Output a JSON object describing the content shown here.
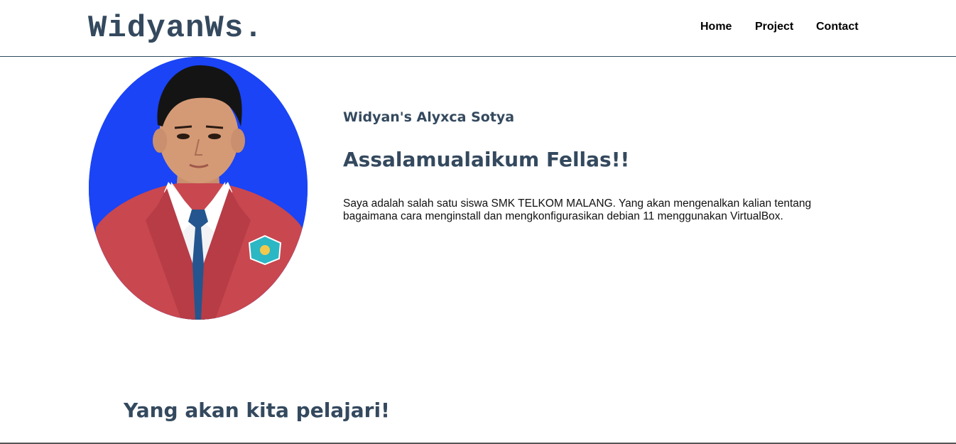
{
  "navbar": {
    "logo": "WidyanWs.",
    "links": [
      {
        "label": "Home"
      },
      {
        "label": "Project"
      },
      {
        "label": "Contact"
      }
    ]
  },
  "hero": {
    "photo_description": "profile-photo",
    "name": "Widyan's Alyxca Sotya",
    "greeting": "Assalamualaikum Fellas!!",
    "intro_line_1": "Saya adalah salah satu siswa SMK TELKOM MALANG. Yang akan mengenalkan kalian tentang",
    "intro_line_2": "bagaimana cara menginstall dan mengkonfigurasikan debian 11 menggunakan VirtualBox."
  },
  "section": {
    "title": "Yang akan kita pelajari!"
  },
  "colors": {
    "heading": "#34495e",
    "photo_background": "#1a44f5",
    "blazer": "#c9474f"
  }
}
